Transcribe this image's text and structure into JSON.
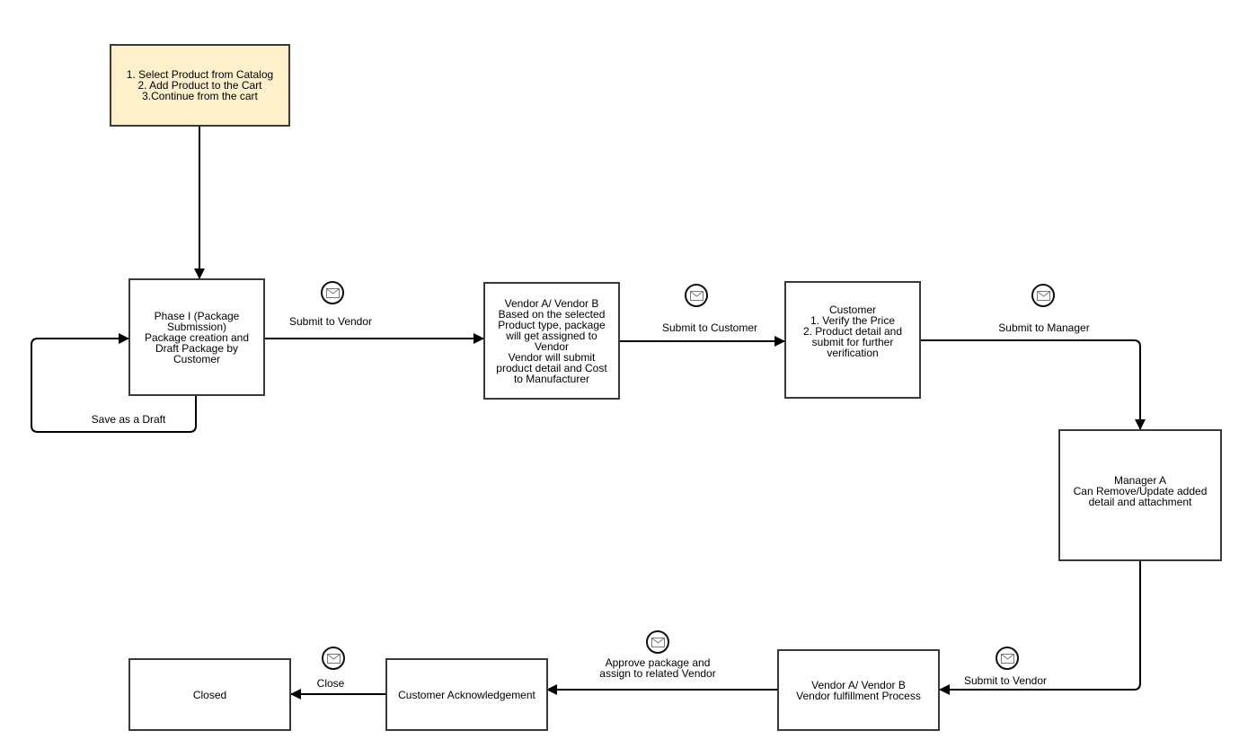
{
  "diagram": {
    "colors": {
      "start_fill": "#fff0cc",
      "task_fill": "#ffffff",
      "stroke": "#3a3a3a",
      "edge": "#000000"
    },
    "nodes": {
      "start": {
        "text": "1. Select Product from Catalog\n2. Add Product to the Cart\n3.Continue from the cart"
      },
      "phase1": {
        "text": "Phase I (Package\nSubmission)\nPackage creation and\nDraft Package by\nCustomer"
      },
      "vendor_assign": {
        "text": "Vendor A/ Vendor B\nBased on the selected\nProduct type, package\nwill get assigned to\nVendor\nVendor will submit\nproduct detail and Cost\nto Manufacturer"
      },
      "customer_verify": {
        "text": "Customer\n1. Verify the Price\n2. Product detail and\nsubmit for further\nverification"
      },
      "manager": {
        "text": "Manager A\nCan Remove/Update added\ndetail and attachment"
      },
      "vendor_fulfill": {
        "text": "Vendor A/ Vendor B\nVendor fulfillment Process"
      },
      "customer_ack": {
        "text": "Customer Acknowledgement"
      },
      "closed": {
        "text": "Closed"
      }
    },
    "edges": {
      "save_draft": {
        "label": "Save as a Draft",
        "icon": "none"
      },
      "submit_vendor_1": {
        "label": "Submit to Vendor",
        "icon": "envelope-icon"
      },
      "submit_customer": {
        "label": "Submit to Customer",
        "icon": "envelope-icon"
      },
      "submit_manager": {
        "label": "Submit to Manager",
        "icon": "envelope-icon"
      },
      "submit_vendor_2": {
        "label": "Submit to Vendor",
        "icon": "envelope-icon"
      },
      "approve_assign": {
        "label": "Approve package and\nassign to related Vendor",
        "icon": "envelope-icon"
      },
      "close": {
        "label": "Close",
        "icon": "envelope-icon"
      }
    }
  }
}
